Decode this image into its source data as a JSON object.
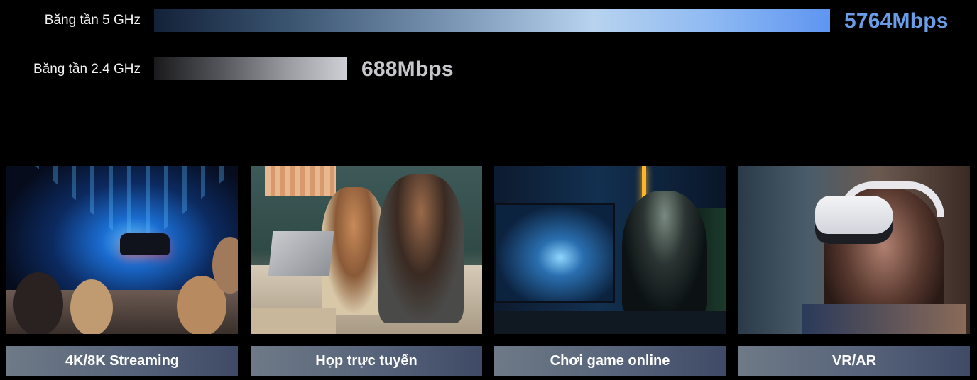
{
  "bands": [
    {
      "label": "Băng tần 5 GHz",
      "speed": "5764Mbps",
      "speed_mbps": 5764
    },
    {
      "label": "Băng tần 2.4 GHz",
      "speed": "688Mbps",
      "speed_mbps": 688
    }
  ],
  "colors": {
    "background": "#000000",
    "speed_5g": "#6a9de8",
    "speed_24g": "#c8c8cc",
    "caption_bg": "#56637a"
  },
  "cards": [
    {
      "caption": "4K/8K Streaming",
      "image": "streaming-scene"
    },
    {
      "caption": "Họp trực tuyến",
      "image": "video-meeting-scene"
    },
    {
      "caption": "Chơi game online",
      "image": "gaming-scene"
    },
    {
      "caption": "VR/AR",
      "image": "vr-headset-scene"
    }
  ]
}
